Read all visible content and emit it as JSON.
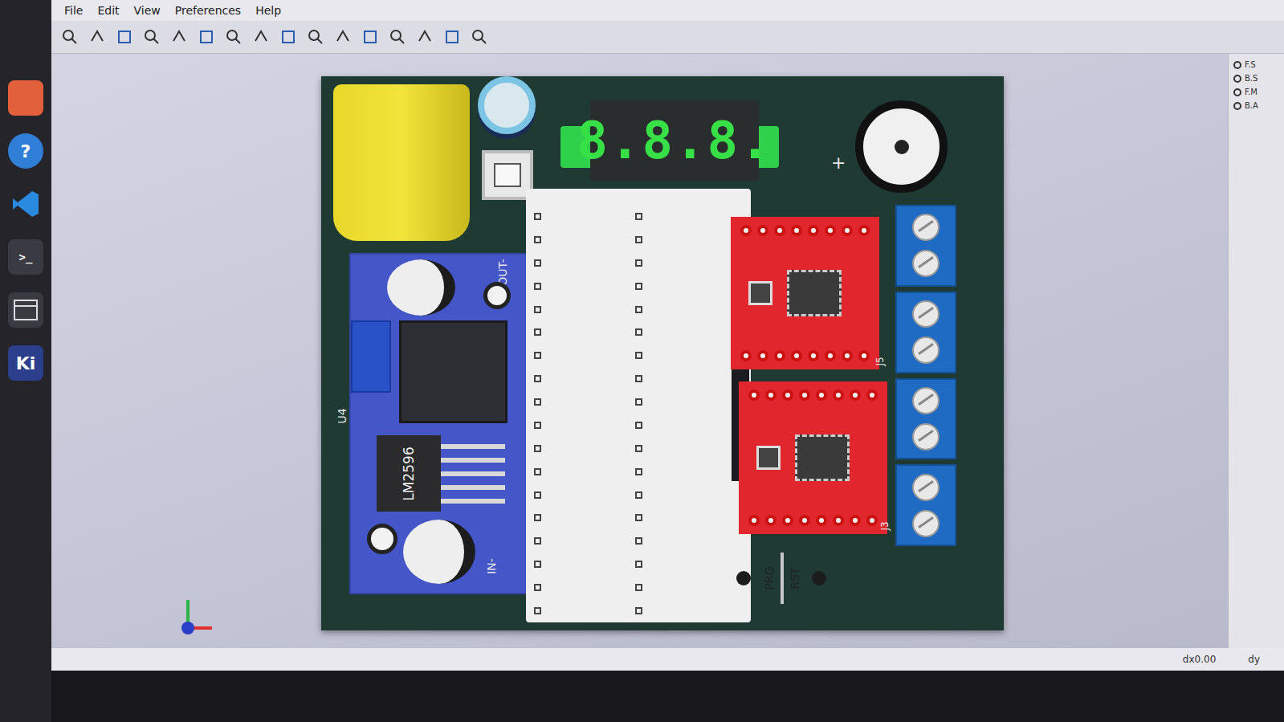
{
  "window": {
    "menu": [
      "File",
      "Edit",
      "View",
      "Preferences",
      "Help"
    ]
  },
  "dock": {
    "items": [
      {
        "kind": "app",
        "label": ""
      },
      {
        "kind": "help",
        "label": "?"
      },
      {
        "kind": "vscode",
        "label": ""
      },
      {
        "kind": "terminal",
        "label": ">_"
      },
      {
        "kind": "window",
        "label": ""
      },
      {
        "kind": "kicad",
        "label": "Ki"
      }
    ]
  },
  "board": {
    "display": "8.8.8.",
    "buzzer": {
      "polarity": "+"
    },
    "buck_module": {
      "chip": "LM2596",
      "ref": "U4",
      "out_label": "OUT-",
      "in_label": "IN-"
    },
    "mcu": {
      "buttons": [
        "PRG",
        "RST"
      ]
    },
    "drivers": [
      {
        "ref": "J5"
      },
      {
        "ref": "J3"
      }
    ]
  },
  "layers": [
    "F.S",
    "B.S",
    "F.M",
    "B.A"
  ],
  "status_bar": {
    "dx": "dx0.00",
    "dy": "dy"
  }
}
